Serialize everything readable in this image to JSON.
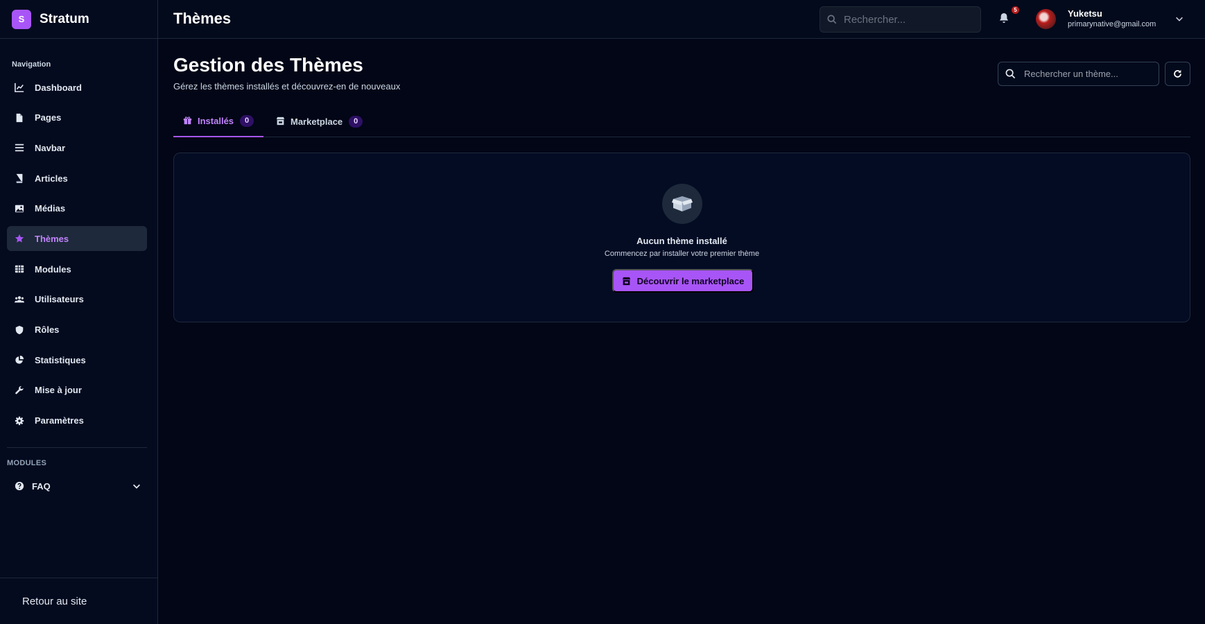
{
  "brand": {
    "logo_letter": "S",
    "name": "Stratum"
  },
  "sidebar": {
    "section_label": "Navigation",
    "items": [
      {
        "label": "Dashboard",
        "icon": "chart-line-icon",
        "active": false
      },
      {
        "label": "Pages",
        "icon": "file-icon",
        "active": false
      },
      {
        "label": "Navbar",
        "icon": "menu-icon",
        "active": false
      },
      {
        "label": "Articles",
        "icon": "book-icon",
        "active": false
      },
      {
        "label": "Médias",
        "icon": "image-icon",
        "active": false
      },
      {
        "label": "Thèmes",
        "icon": "star-icon",
        "active": true
      },
      {
        "label": "Modules",
        "icon": "grid-icon",
        "active": false
      },
      {
        "label": "Utilisateurs",
        "icon": "users-icon",
        "active": false
      },
      {
        "label": "Rôles",
        "icon": "shield-icon",
        "active": false
      },
      {
        "label": "Statistiques",
        "icon": "pie-chart-icon",
        "active": false
      },
      {
        "label": "Mise à jour",
        "icon": "wrench-icon",
        "active": false
      },
      {
        "label": "Paramètres",
        "icon": "gear-icon",
        "active": false
      }
    ],
    "modules_label": "MODULES",
    "modules": [
      {
        "label": "FAQ",
        "icon": "question-circle-icon"
      }
    ],
    "footer_link": "Retour au site"
  },
  "topbar": {
    "title": "Thèmes",
    "search_placeholder": "Rechercher...",
    "notification_count": "5",
    "user_name": "Yuketsu",
    "user_email": "primarynative@gmail.com"
  },
  "main": {
    "heading": "Gestion des Thèmes",
    "subheading": "Gérez les thèmes installés et découvrez-en de nouveaux",
    "search_placeholder": "Rechercher un thème...",
    "tabs": [
      {
        "label": "Installés",
        "count": "0",
        "icon": "gift-icon",
        "active": true
      },
      {
        "label": "Marketplace",
        "count": "0",
        "icon": "store-icon",
        "active": false
      }
    ],
    "empty_state": {
      "icon": "box-open-icon",
      "title": "Aucun thème installé",
      "text": "Commencez par installer votre premier thème",
      "button_label": "Découvrir le marketplace"
    }
  },
  "colors": {
    "accent": "#a855f7",
    "background": "#020617",
    "sidebar_bg": "#040b1f",
    "active_item_bg": "#1e293b",
    "badge_red": "#b91c1c"
  }
}
